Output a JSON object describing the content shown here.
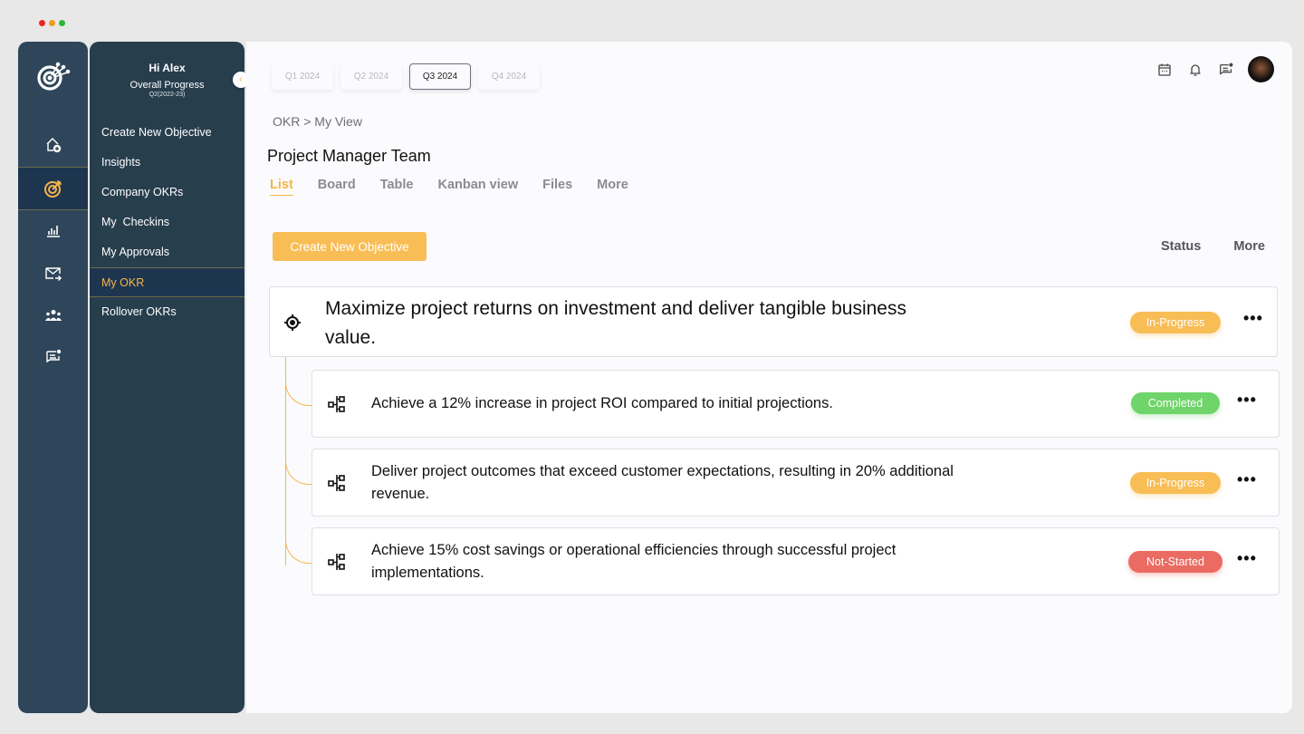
{
  "window": {
    "controls": [
      "close",
      "minimize",
      "maximize"
    ],
    "control_colors": [
      "#e8281e",
      "#f19a1b",
      "#2eb82e"
    ]
  },
  "rail": {
    "logo": "target-logo-icon",
    "items": [
      {
        "icon": "home-add-icon",
        "active": false
      },
      {
        "icon": "target-icon",
        "active": true
      },
      {
        "icon": "bar-chart-icon",
        "active": false
      },
      {
        "icon": "mail-forward-icon",
        "active": false
      },
      {
        "icon": "team-icon",
        "active": false
      },
      {
        "icon": "chat-notification-icon",
        "active": false
      }
    ]
  },
  "panel": {
    "greeting": "Hi Alex",
    "progress_label": "Overall Progress",
    "progress_period": "Q2(2022-23)",
    "menu": [
      {
        "label": "Create New Objective",
        "active": false
      },
      {
        "label": "Insights",
        "active": false
      },
      {
        "label": "Company OKRs",
        "active": false
      },
      {
        "label": "My  Checkins",
        "active": false
      },
      {
        "label": "My Approvals",
        "active": false
      },
      {
        "label": "My OKR",
        "active": true
      },
      {
        "label": "Rollover OKRs",
        "active": false
      }
    ]
  },
  "quarters": [
    {
      "label": "Q1 2024",
      "active": false
    },
    {
      "label": "Q2 2024",
      "active": false
    },
    {
      "label": "Q3 2024",
      "active": true
    },
    {
      "label": "Q4 2024",
      "active": false
    }
  ],
  "header_icons": [
    "calendar-icon",
    "bell-icon",
    "chat-notification-icon",
    "avatar"
  ],
  "breadcrumb": "OKR > My View",
  "page_title": "Project Manager Team",
  "view_tabs": [
    {
      "label": "List",
      "active": true
    },
    {
      "label": "Board",
      "active": false
    },
    {
      "label": "Table",
      "active": false
    },
    {
      "label": "Kanban view",
      "active": false
    },
    {
      "label": "Files",
      "active": false
    },
    {
      "label": "More",
      "active": false
    }
  ],
  "create_button": "Create New Objective",
  "actions": {
    "status": "Status",
    "more": "More"
  },
  "colors": {
    "accent": "#f5b54b",
    "in_progress": "#f8bd55",
    "completed": "#6fd46a",
    "not_started": "#ea6b62"
  },
  "objective": {
    "text": "Maximize project returns on investment and deliver tangible business value.",
    "status": "In-Progress",
    "key_results": [
      {
        "text": "Achieve a 12% increase in project ROI compared to initial projections.",
        "status": "Completed"
      },
      {
        "text": "Deliver project outcomes that exceed customer expectations, resulting in 20% additional revenue.",
        "status": "In-Progress"
      },
      {
        "text": "Achieve 15% cost savings or operational efficiencies through successful project implementations.",
        "status": "Not-Started"
      }
    ]
  },
  "more_menu_glyph": "•••"
}
